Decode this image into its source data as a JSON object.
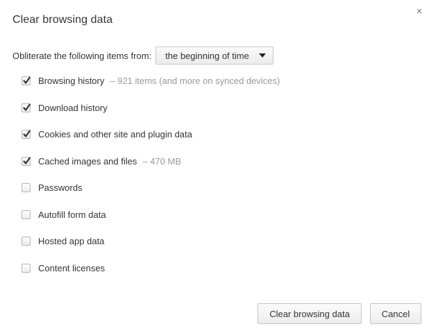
{
  "dialog": {
    "title": "Clear browsing data",
    "close_icon": "close-icon",
    "close_glyph": "×"
  },
  "range": {
    "label": "Obliterate the following items from:",
    "selected": "the beginning of time"
  },
  "options": [
    {
      "label": "Browsing history",
      "detail": "–  921 items (and more on synced devices)",
      "checked": true
    },
    {
      "label": "Download history",
      "detail": "",
      "checked": true
    },
    {
      "label": "Cookies and other site and plugin data",
      "detail": "",
      "checked": true
    },
    {
      "label": "Cached images and files",
      "detail": "–  470 MB",
      "checked": true
    },
    {
      "label": "Passwords",
      "detail": "",
      "checked": false
    },
    {
      "label": "Autofill form data",
      "detail": "",
      "checked": false
    },
    {
      "label": "Hosted app data",
      "detail": "",
      "checked": false
    },
    {
      "label": "Content licenses",
      "detail": "",
      "checked": false
    }
  ],
  "buttons": {
    "clear_label": "Clear browsing data",
    "cancel_label": "Cancel"
  }
}
